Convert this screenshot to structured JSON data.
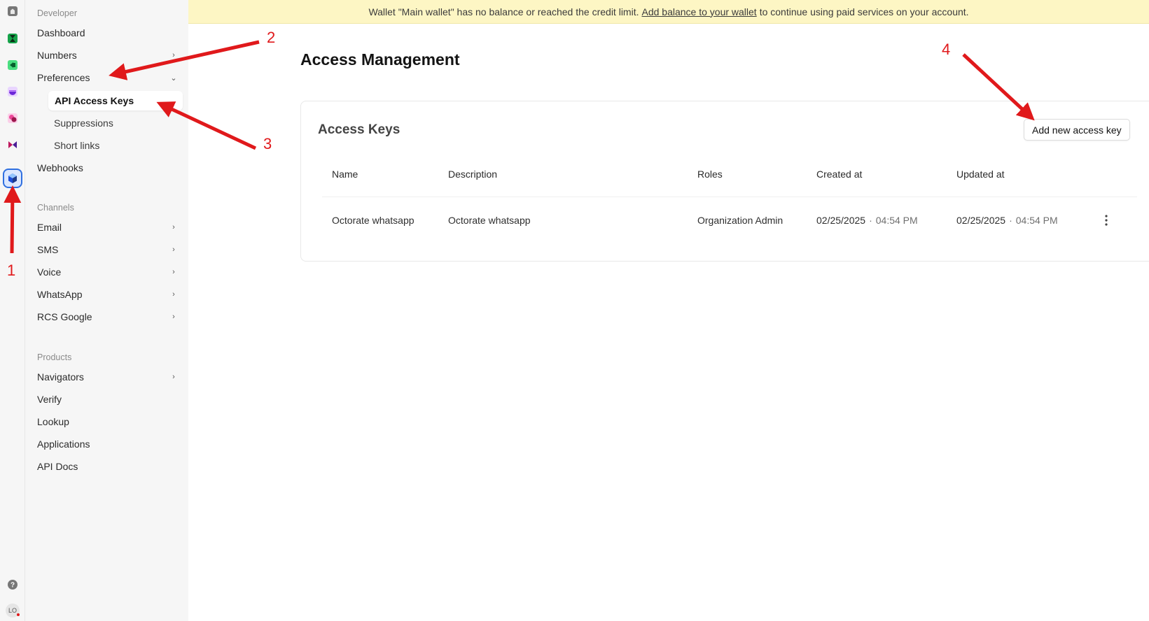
{
  "banner": {
    "text_before": "Wallet \"Main wallet\" has no balance or reached the credit limit.",
    "link": "Add balance to your wallet",
    "text_after": "to continue using paid services on your account."
  },
  "rail": {
    "items": [
      {
        "icon": "home-icon"
      },
      {
        "icon": "hourglass-icon"
      },
      {
        "icon": "video-icon"
      },
      {
        "icon": "bowl-icon"
      },
      {
        "icon": "circles-icon"
      },
      {
        "icon": "bowtie-icon"
      },
      {
        "icon": "developer-cube-icon"
      }
    ],
    "help_icon": "help-icon",
    "avatar": "LO"
  },
  "sidebar": {
    "developer_label": "Developer",
    "dashboard": "Dashboard",
    "numbers": "Numbers",
    "preferences": "Preferences",
    "preferences_sub": [
      "API Access Keys",
      "Suppressions",
      "Short links"
    ],
    "webhooks": "Webhooks",
    "channels_label": "Channels",
    "channels": [
      "Email",
      "SMS",
      "Voice",
      "WhatsApp",
      "RCS Google"
    ],
    "products_label": "Products",
    "products": [
      "Navigators",
      "Verify",
      "Lookup",
      "Applications",
      "API Docs"
    ]
  },
  "main": {
    "title": "Access Management",
    "card_title": "Access Keys",
    "add_button": "Add new access key",
    "columns": [
      "Name",
      "Description",
      "Roles",
      "Created at",
      "Updated at"
    ],
    "rows": [
      {
        "name": "Octorate whatsapp",
        "description": "Octorate whatsapp",
        "roles": "Organization Admin",
        "created_date": "02/25/2025",
        "created_time": "04:54 PM",
        "updated_date": "02/25/2025",
        "updated_time": "04:54 PM"
      }
    ]
  },
  "annotations": [
    "1",
    "2",
    "3",
    "4"
  ],
  "colors": {
    "banner_bg": "#fdf6c4",
    "sidebar_bg": "#f6f6f6",
    "annotation_red": "#e0191b",
    "active_rail": "#2f6fe0"
  }
}
